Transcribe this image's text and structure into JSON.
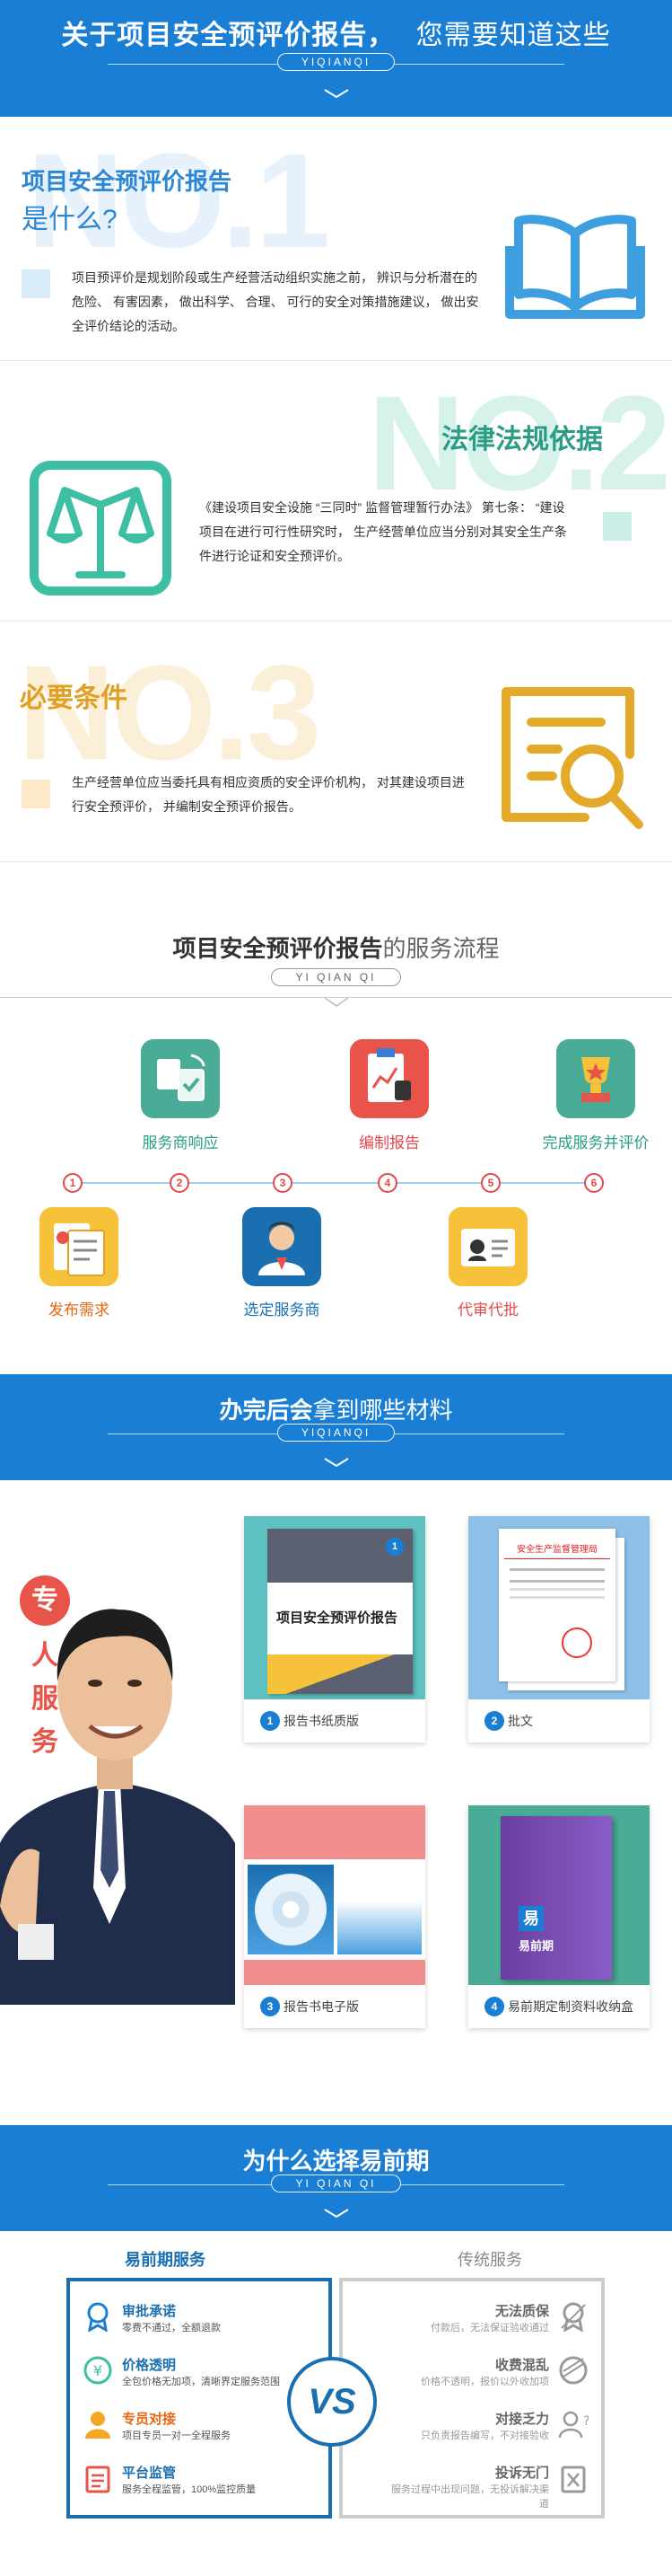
{
  "header": {
    "title_left": "关于项目安全预评价报告，",
    "title_right": "您需要知道这些",
    "subtitle": "YIQIANQI"
  },
  "sec1": {
    "number": "NO.1",
    "title_line1": "项目安全预评价报告",
    "title_line2": "是什么?",
    "text": "项目预评价是规划阶段或生产经营活动组织实施之前， 辨识与分析潜在的危险、 有害因素， 做出科学、 合理、 可行的安全对策措施建议， 做出安全评价结论的活动。",
    "icon": "book-icon",
    "color": "#3d9ee0"
  },
  "sec2": {
    "number": "NO.2",
    "title": "法律法规依据",
    "text": "《建设项目安全设施 “三同时” 监督管理暂行办法》 第七条： “建设项目在进行可行性研究时， 生产经营单位应当分别对其安全生产条件进行论证和安全预评价。",
    "icon": "scales-icon",
    "color": "#3ebfa3"
  },
  "sec3": {
    "number": "NO.3",
    "title": "必要条件",
    "text": "生产经营单位应当委托具有相应资质的安全评价机构， 对其建设项目进行安全预评价， 并编制安全预评价报告。",
    "icon": "document-search-icon",
    "color": "#e5a92a"
  },
  "flow": {
    "title_main": "项目安全预评价报告",
    "title_suffix": "的服务流程",
    "subtitle": "YI QIAN QI",
    "steps_top": [
      "服务商响应",
      "编制报告",
      "完成服务并评价"
    ],
    "steps_bottom": [
      "发布需求",
      "选定服务商",
      "代审代批"
    ],
    "numbers": [
      "1",
      "2",
      "3",
      "4",
      "5",
      "6"
    ]
  },
  "materials": {
    "title_left": "办完后会",
    "title_right": "拿到哪些材料",
    "subtitle": "YIQIANQI",
    "badge": [
      "专",
      "人",
      "服",
      "务"
    ],
    "cards": [
      {
        "num": "1",
        "label": "报告书纸质版",
        "book_title": "项目安全预评价报告",
        "book_badge": "1"
      },
      {
        "num": "2",
        "label": "批文",
        "doc_title": "安全生产监督管理局"
      },
      {
        "num": "3",
        "label": "报告书电子版"
      },
      {
        "num": "4",
        "label": "易前期定制资料收纳盒",
        "box_brand": "易",
        "box_name": "易前期"
      }
    ]
  },
  "why": {
    "title": "为什么选择易前期",
    "subtitle": "YI QIAN QI",
    "left_head": "易前期服务",
    "right_head": "传统服务",
    "vs": "VS",
    "left": [
      {
        "title": "审批承诺",
        "desc": "零费不通过，全额退款"
      },
      {
        "title": "价格透明",
        "desc": "全包价格无加项，清晰界定服务范围"
      },
      {
        "title": "专员对接",
        "desc": "项目专员一对一全程服务"
      },
      {
        "title": "平台监管",
        "desc": "服务全程监管，100%监控质量"
      }
    ],
    "right": [
      {
        "title": "无法质保",
        "desc": "付款后，无法保证验收通过"
      },
      {
        "title": "收费混乱",
        "desc": "价格不透明，报价以外收加项"
      },
      {
        "title": "对接乏力",
        "desc": "只负责报告编写，不对接验收"
      },
      {
        "title": "投诉无门",
        "desc": "服务过程中出现问题，无投诉解决渠道"
      }
    ]
  }
}
